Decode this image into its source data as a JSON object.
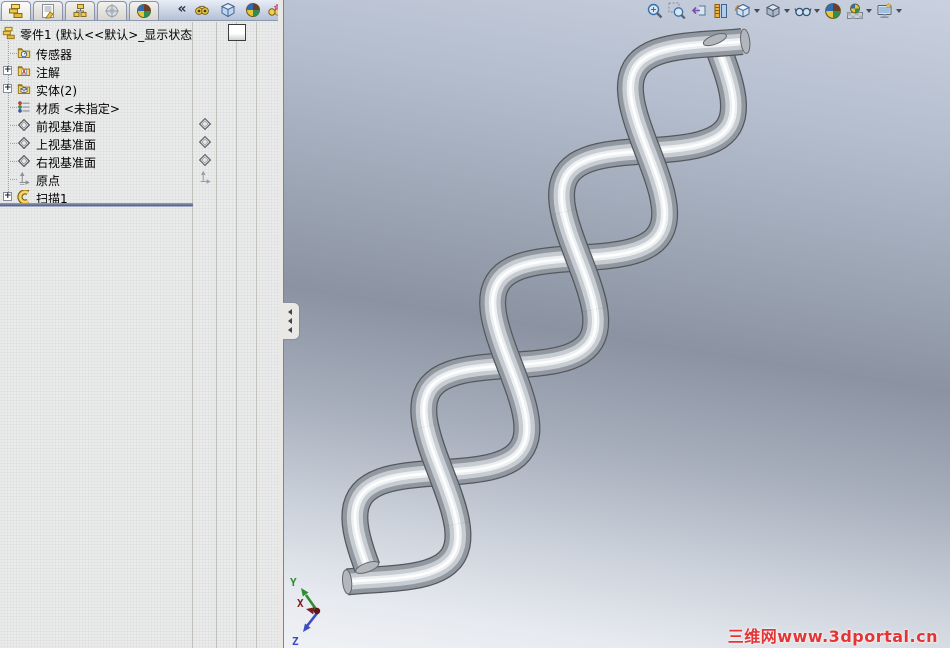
{
  "panel": {
    "tabs": [
      {
        "icon": "feature-tree",
        "name": "featuremanager",
        "active": true
      },
      {
        "icon": "property-manager",
        "name": "propertymanager",
        "active": false
      },
      {
        "icon": "configuration-manager",
        "name": "configurationmanager",
        "active": false
      },
      {
        "icon": "dimxpert",
        "name": "dimxpertmanager",
        "active": false
      },
      {
        "icon": "display-manager",
        "name": "displaymanager",
        "active": false
      }
    ],
    "collapse_glyph": "«",
    "display_pane_icons": [
      "hide-show",
      "display-mode",
      "appearance",
      "transparency"
    ],
    "tree": {
      "root_label": "零件1 (默认<<默认>_显示状态",
      "items": [
        {
          "label": "传感器",
          "icon": "sensors",
          "expandable": false,
          "ghost": null
        },
        {
          "label": "注解",
          "icon": "annotations",
          "expandable": true,
          "ghost": null
        },
        {
          "label": "实体(2)",
          "icon": "solid-bodies",
          "expandable": true,
          "ghost": null
        },
        {
          "label": "材质 <未指定>",
          "icon": "material",
          "expandable": false,
          "ghost": null
        },
        {
          "label": "前视基准面",
          "icon": "plane",
          "expandable": false,
          "ghost": "plane"
        },
        {
          "label": "上视基准面",
          "icon": "plane",
          "expandable": false,
          "ghost": "plane"
        },
        {
          "label": "右视基准面",
          "icon": "plane",
          "expandable": false,
          "ghost": "plane"
        },
        {
          "label": "原点",
          "icon": "origin",
          "expandable": false,
          "ghost": "origin"
        },
        {
          "label": "扫描1",
          "icon": "sweep",
          "expandable": true,
          "ghost": null
        }
      ]
    }
  },
  "headsup": [
    {
      "icon": "zoom-fit",
      "arrow": false
    },
    {
      "icon": "zoom-area",
      "arrow": false
    },
    {
      "icon": "previous-view",
      "arrow": false
    },
    {
      "icon": "section-view",
      "arrow": false
    },
    {
      "icon": "view-orientation",
      "arrow": true
    },
    {
      "icon": "display-style",
      "arrow": true
    },
    {
      "icon": "hide-show-items",
      "arrow": true
    },
    {
      "icon": "edit-appearance",
      "arrow": false
    },
    {
      "icon": "apply-scene",
      "arrow": true
    },
    {
      "icon": "view-settings",
      "arrow": true
    }
  ],
  "viewport": {
    "triad": {
      "x": "X",
      "y": "Y",
      "z": "Z"
    },
    "watermark": "三维网www.3dportal.cn"
  },
  "colors": {
    "axis_x": "#7a1f1f",
    "axis_y": "#2d8f2d",
    "axis_z": "#3c4cc0",
    "watermark": "#e23535",
    "rollback_bar": "#55628c"
  }
}
